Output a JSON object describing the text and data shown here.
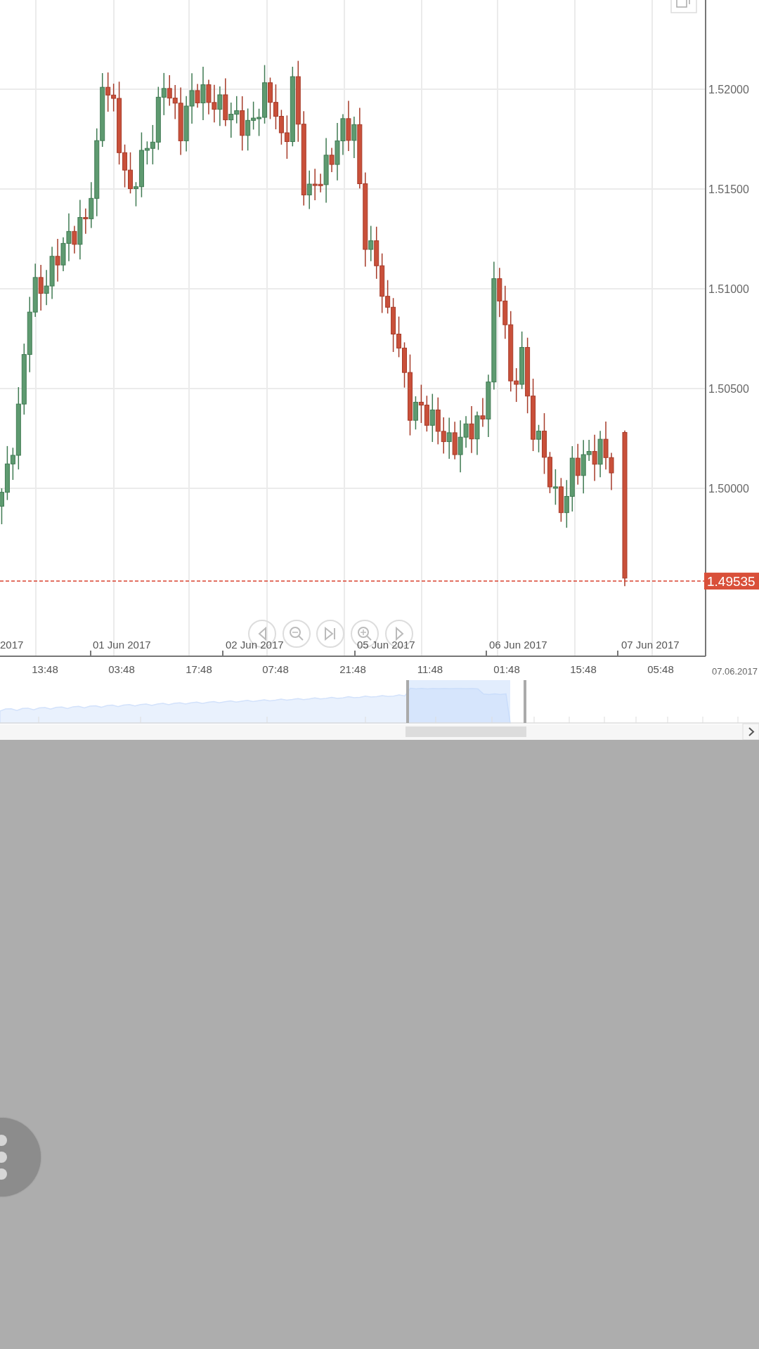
{
  "chart": {
    "price_labels": [
      "1.52000",
      "1.51500",
      "1.51000",
      "1.50500",
      "1.50000"
    ],
    "current_price": "1.49535",
    "date_labels": [
      "2017",
      "01 Jun 2017",
      "02 Jun 2017",
      "05 Jun 2017",
      "06 Jun 2017",
      "07 Jun 2017"
    ],
    "time_labels": [
      "13:48",
      "03:48",
      "17:48",
      "07:48",
      "21:48",
      "11:48",
      "01:48",
      "15:48",
      "05:48"
    ],
    "navigator_date": "07.06.2017"
  }
}
